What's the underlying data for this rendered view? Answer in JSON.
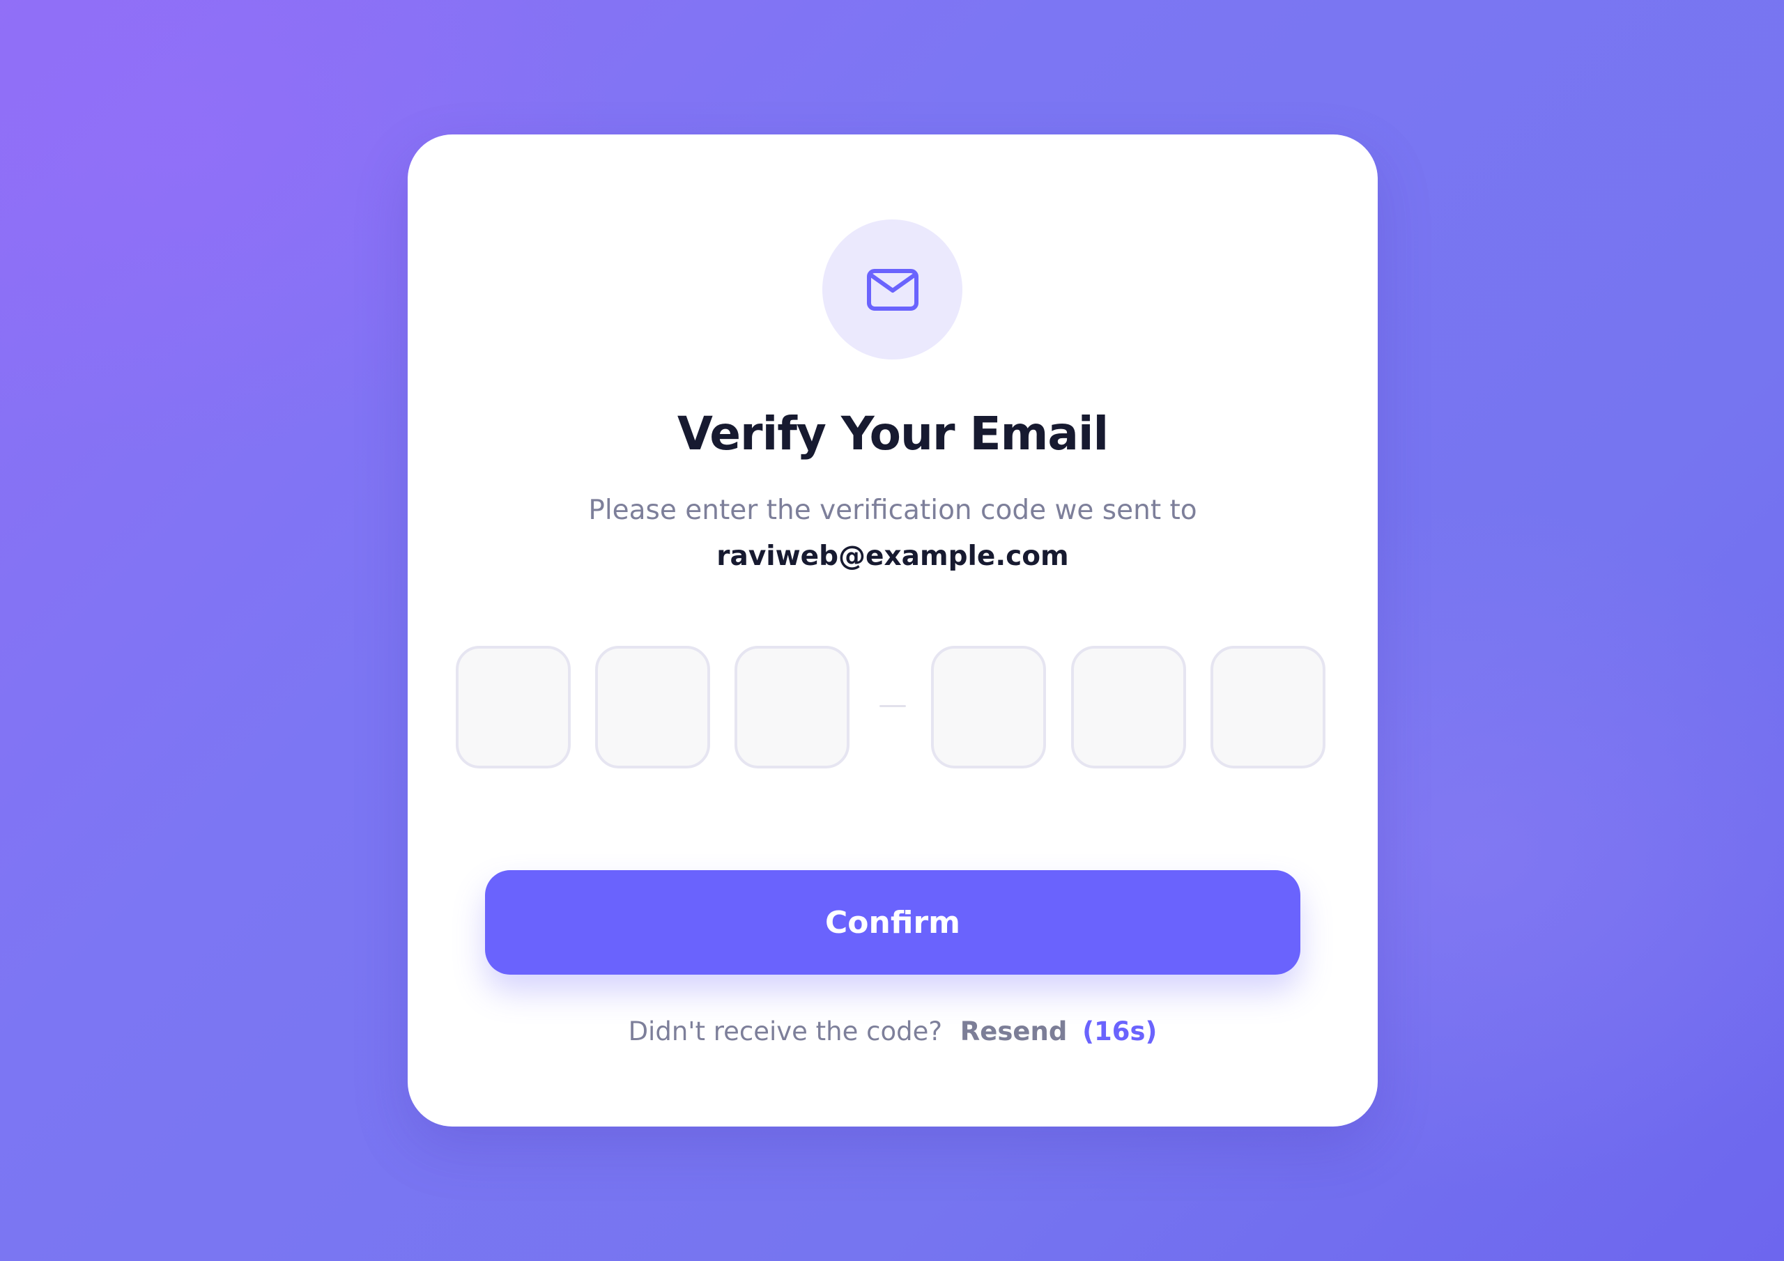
{
  "icon": "envelope-icon",
  "title": "Verify Your Email",
  "subtitle": "Please enter the verification code we sent to",
  "email": "raviweb@example.com",
  "otp": {
    "digits": [
      "",
      "",
      "",
      "",
      "",
      ""
    ],
    "separator_icon": "dash"
  },
  "confirm_label": "Confirm",
  "resend": {
    "prompt": "Didn't receive the code?",
    "link_label": "Resend",
    "timer": "(16s)"
  },
  "colors": {
    "accent": "#6a63fd",
    "icon_bg": "#ebe9fd",
    "title": "#171a30",
    "muted_text": "#7d7f9a",
    "input_border": "#e6e5f1",
    "input_bg": "#f8f8f9",
    "background_start": "#8f6ff6",
    "background_end": "#6d66ee"
  }
}
